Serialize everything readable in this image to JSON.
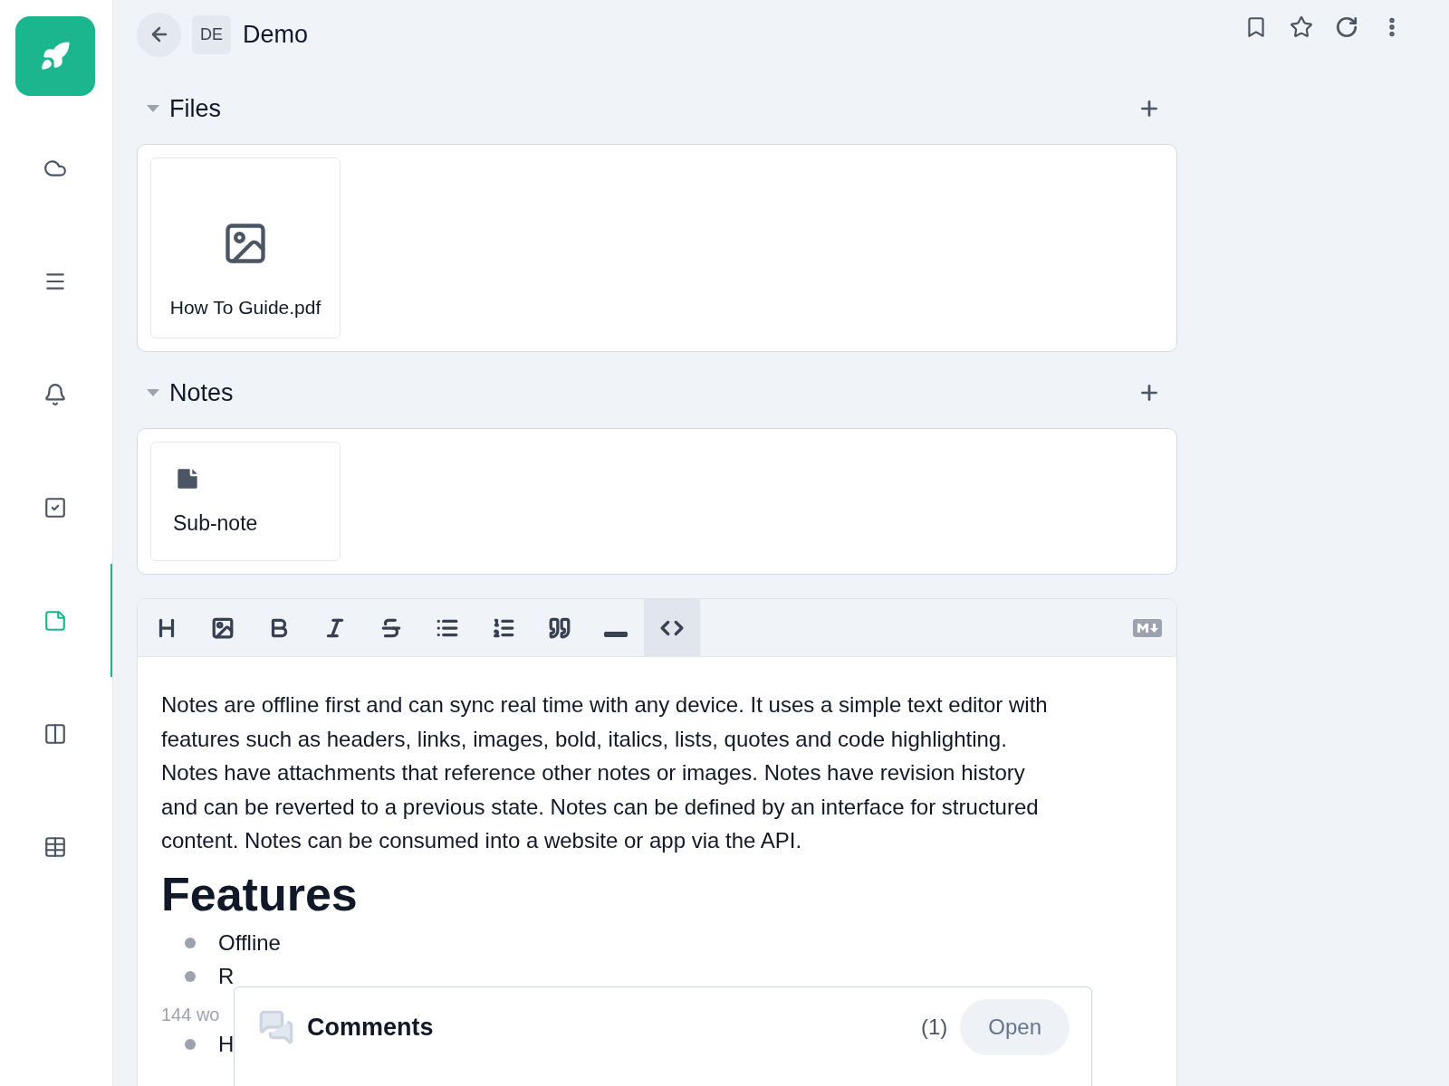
{
  "sidebar": {
    "items": [
      {
        "selected": false
      },
      {
        "selected": false
      },
      {
        "selected": false
      },
      {
        "selected": false
      },
      {
        "selected": true
      },
      {
        "selected": false
      },
      {
        "selected": false
      }
    ]
  },
  "header": {
    "badge": "DE",
    "title": "Demo"
  },
  "sections": [
    {
      "title": "Files",
      "expanded": true,
      "items": [
        {
          "kind": "file",
          "name": "How To Guide.pdf"
        }
      ]
    },
    {
      "title": "Notes",
      "expanded": true,
      "items": [
        {
          "kind": "note",
          "name": "Sub-note"
        }
      ]
    }
  ],
  "toolbar": {
    "buttons": [
      {
        "selected": false
      },
      {
        "selected": false
      },
      {
        "selected": false
      },
      {
        "selected": false
      },
      {
        "selected": false
      },
      {
        "selected": false
      },
      {
        "selected": false
      },
      {
        "selected": false
      },
      {
        "selected": false
      },
      {
        "selected": true
      }
    ]
  },
  "editor": {
    "paragraph": "Notes are offline first and can sync real time with any device. It uses a simple text editor with features such as headers, links, images, bold, italics, lists, quotes and code highlighting. Notes have attachments that reference other notes or images. Notes have revision history and can be reverted to a previous state. Notes can be defined by an interface for structured content. Notes can be consumed into a website or app via the API.",
    "heading": "Features",
    "list": [
      "Offline",
      "R"
    ],
    "word_count": "144 wo",
    "list_more": [
      "H"
    ]
  },
  "comments": {
    "title": "Comments",
    "count": "(1)",
    "button": "Open"
  }
}
